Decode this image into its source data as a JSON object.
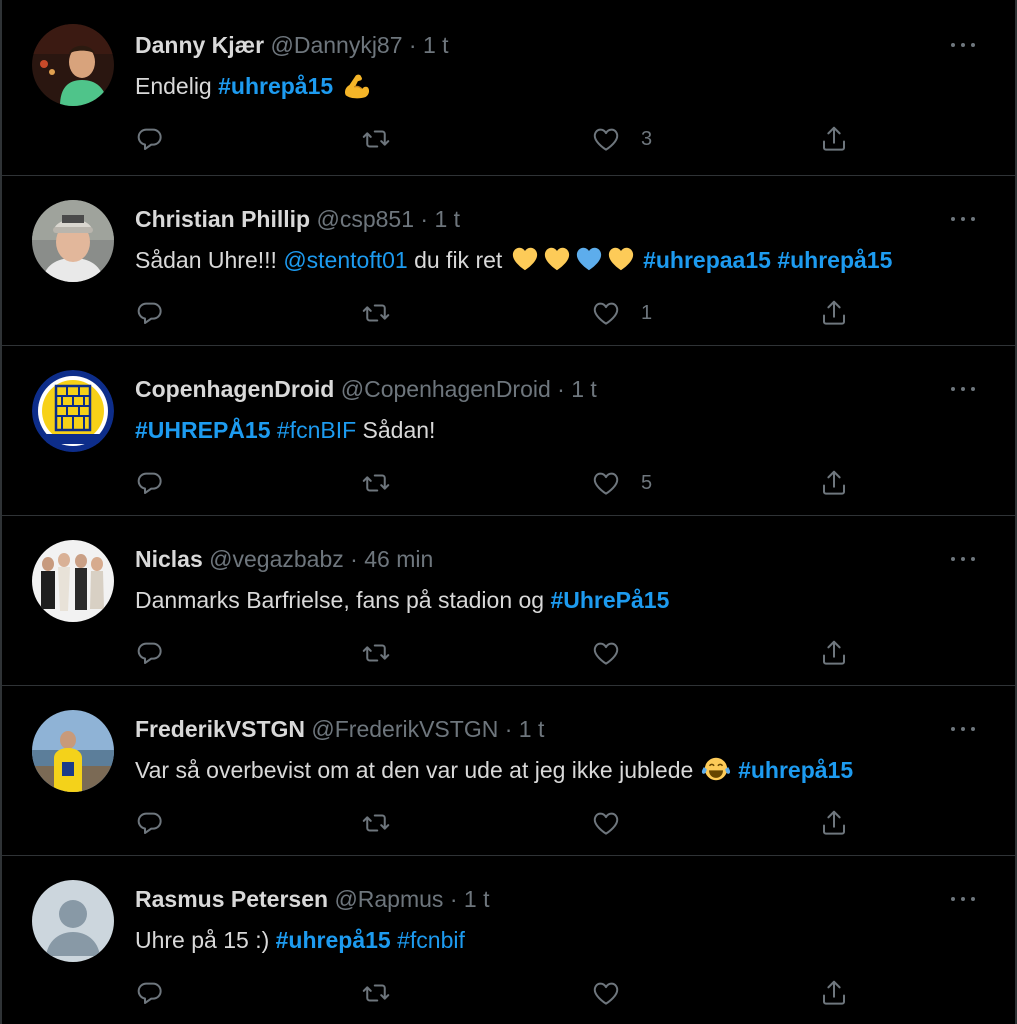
{
  "tweets": [
    {
      "name": "Danny Kjær",
      "handle": "@Dannykj87",
      "time": "1 t",
      "text": [
        {
          "t": "Endelig ",
          "k": "plain"
        },
        {
          "t": "#uhrepå15",
          "k": "tag"
        },
        {
          "t": " ",
          "k": "plain"
        },
        {
          "t": "flexed-biceps-emoji",
          "k": "emoji",
          "e": "flex"
        }
      ],
      "likes": "3",
      "avatar": "photo-man-green-shirt"
    },
    {
      "name": "Christian Phillip",
      "handle": "@csp851",
      "time": "1 t",
      "text": [
        {
          "t": "Sådan Uhre!!! ",
          "k": "plain"
        },
        {
          "t": "@stentoft01",
          "k": "mention"
        },
        {
          "t": " du fik ret ",
          "k": "plain"
        },
        {
          "t": "yellow-heart-emoji",
          "k": "emoji",
          "e": "yheart"
        },
        {
          "t": "yellow-heart-emoji",
          "k": "emoji",
          "e": "yheart"
        },
        {
          "t": "blue-heart-emoji",
          "k": "emoji",
          "e": "bheart"
        },
        {
          "t": "yellow-heart-emoji",
          "k": "emoji",
          "e": "yheart"
        },
        {
          "t": " ",
          "k": "plain"
        },
        {
          "t": "#uhrepaa15",
          "k": "tag"
        },
        {
          "t": " ",
          "k": "plain"
        },
        {
          "t": "#uhrepå15",
          "k": "tag"
        }
      ],
      "likes": "1",
      "avatar": "photo-man-cap"
    },
    {
      "name": "CopenhagenDroid",
      "handle": "@CopenhagenDroid",
      "time": "1 t",
      "text": [
        {
          "t": "#UHREPÅ15",
          "k": "tag"
        },
        {
          "t": " ",
          "k": "plain"
        },
        {
          "t": "#fcnBIF",
          "k": "mention"
        },
        {
          "t": " Sådan!",
          "k": "plain"
        }
      ],
      "likes": "5",
      "avatar": "club-crest-brondby"
    },
    {
      "name": "Niclas",
      "handle": "@vegazbabz",
      "time": "46 min",
      "text": [
        {
          "t": "Danmarks Barfrielse, fans på stadion og ",
          "k": "plain"
        },
        {
          "t": "#UhrePå15",
          "k": "tag"
        }
      ],
      "likes": "",
      "avatar": "photo-group"
    },
    {
      "name": "FrederikVSTGN",
      "handle": "@FrederikVSTGN",
      "time": "1 t",
      "text": [
        {
          "t": "Var så overbevist om at den var ude at jeg ikke jublede ",
          "k": "plain"
        },
        {
          "t": "tears-of-joy-emoji",
          "k": "emoji",
          "e": "joy"
        },
        {
          "t": " ",
          "k": "plain"
        },
        {
          "t": "#uhrepå15",
          "k": "tag"
        }
      ],
      "likes": "",
      "avatar": "photo-yellow-jersey"
    },
    {
      "name": "Rasmus Petersen",
      "handle": "@Rapmus",
      "time": "1 t",
      "text": [
        {
          "t": "Uhre på 15 :) ",
          "k": "plain"
        },
        {
          "t": "#uhrepå15",
          "k": "tag"
        },
        {
          "t": " ",
          "k": "plain"
        },
        {
          "t": "#fcnbif",
          "k": "mention"
        }
      ],
      "likes": "",
      "avatar": "default-profile"
    }
  ],
  "separator": "·",
  "colors": {
    "background": "#000000",
    "text": "#d9d9d9",
    "muted": "#6e767d",
    "link": "#1d9bf0",
    "divider": "#2f3336"
  },
  "icons": {
    "reply": "reply-icon",
    "retweet": "retweet-icon",
    "like": "heart-icon",
    "share": "share-icon",
    "more": "more-icon"
  }
}
